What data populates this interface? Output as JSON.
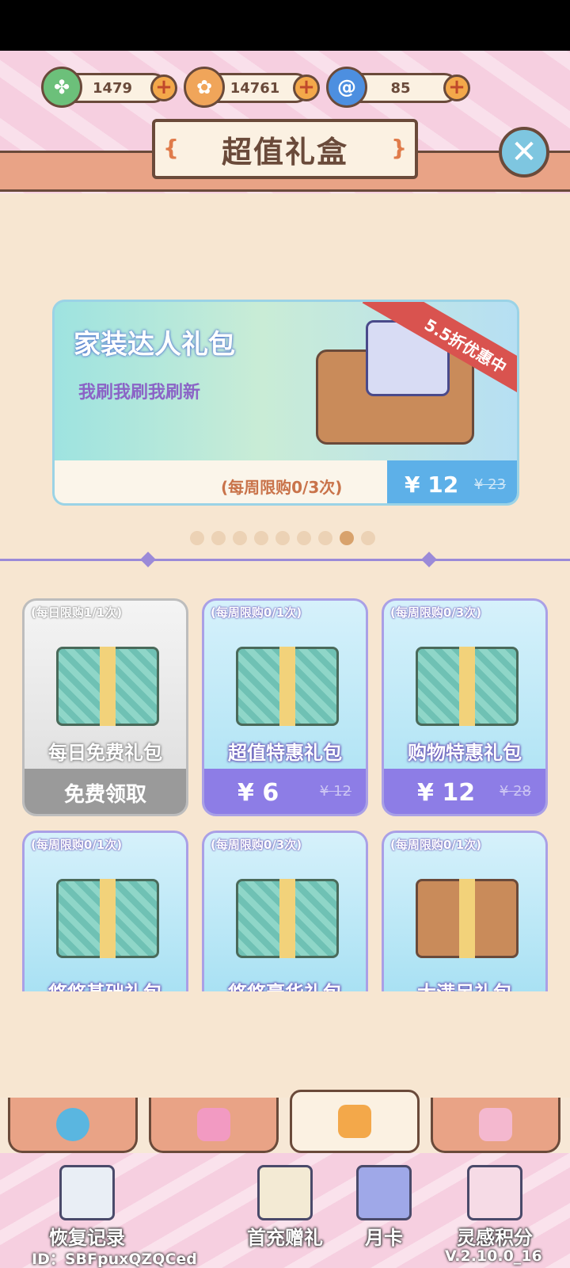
{
  "currencies": [
    {
      "name": "clover",
      "icon": "clover-icon",
      "value": "1479",
      "color": "#6cc07a"
    },
    {
      "name": "coin",
      "icon": "coin-icon",
      "value": "14761",
      "color": "#f0a55a"
    },
    {
      "name": "swirl",
      "icon": "swirl-icon",
      "value": "85",
      "color": "#4d8fe0"
    }
  ],
  "header": {
    "title": "超值礼盒"
  },
  "banner": {
    "title": "家装达人礼包",
    "subtitle": "我刷我刷我刷新",
    "discount": "5.5折优惠中",
    "limit": "(每周限购0/3次)",
    "price": "¥ 12",
    "old_price": "¥ 23"
  },
  "carousel": {
    "count": 9,
    "active": 7
  },
  "cards": [
    {
      "limit": "(每日限购1/1次)",
      "name": "每日免费礼包",
      "price": "免费领取",
      "old_price": ""
    },
    {
      "limit": "(每周限购0/1次)",
      "name": "超值特惠礼包",
      "price": "¥ 6",
      "old_price": "¥ 12"
    },
    {
      "limit": "(每周限购0/3次)",
      "name": "购物特惠礼包",
      "price": "¥ 12",
      "old_price": "¥ 28"
    },
    {
      "limit": "(每周限购0/1次)",
      "name": "悠悠基础礼包",
      "price": "",
      "old_price": ""
    },
    {
      "limit": "(每周限购0/3次)",
      "name": "悠悠豪华礼包",
      "price": "",
      "old_price": ""
    },
    {
      "limit": "(每周限购0/1次)",
      "name": "大满足礼包",
      "price": "",
      "old_price": ""
    }
  ],
  "tabs": [
    {
      "icon": "swirl-tab-icon",
      "color": "#5ab6e0"
    },
    {
      "icon": "shirt-tab-icon",
      "color": "#f29ac2"
    },
    {
      "icon": "gift-tab-icon",
      "color": "#f3a84a",
      "active": true
    },
    {
      "icon": "scroll-tab-icon",
      "color": "#f4b8cf"
    }
  ],
  "footer": {
    "buttons": [
      {
        "label": "恢复记录",
        "icon": "clipboard-icon"
      },
      {
        "label": "首充赠礼",
        "icon": "envelope-icon"
      },
      {
        "label": "月卡",
        "icon": "card-icon"
      },
      {
        "label": "灵感积分",
        "icon": "lightbulb-icon"
      }
    ],
    "id": "ID：SBFpuxQZQCed",
    "version": "V.2.10.0_16"
  }
}
